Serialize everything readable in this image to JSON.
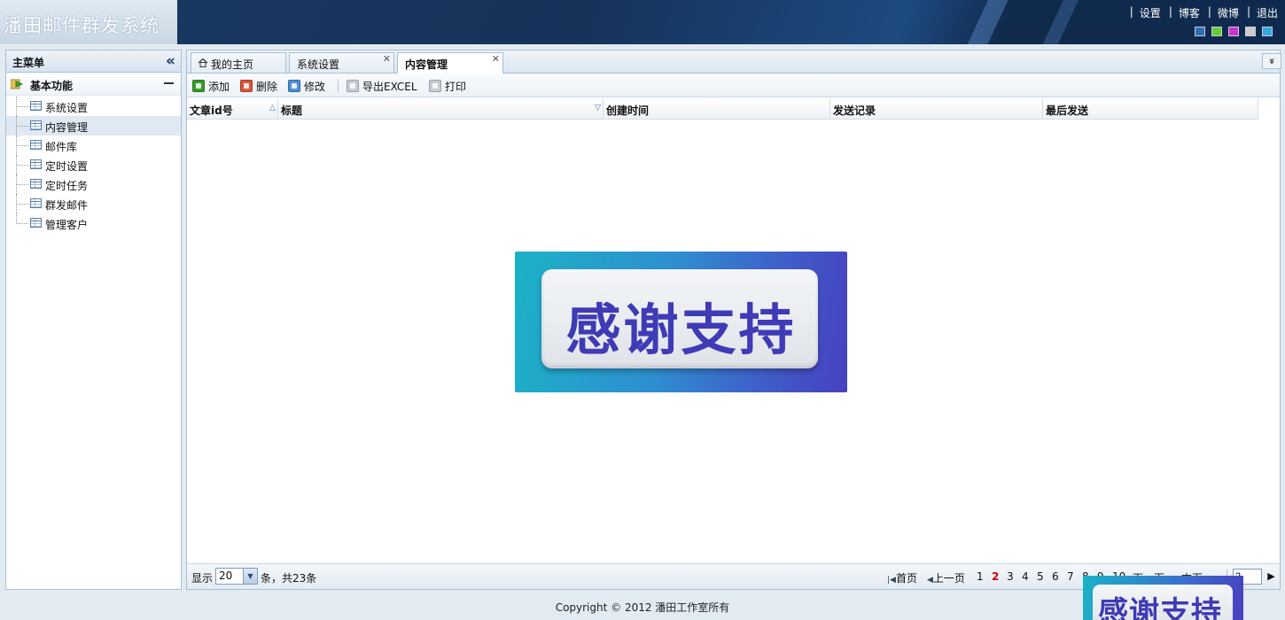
{
  "app": {
    "title": "潘田邮件群发系统"
  },
  "header": {
    "links": [
      "设置",
      "博客",
      "微博",
      "退出"
    ],
    "separator": "|",
    "themes": [
      "#2f6fb0",
      "#66cc33",
      "#cc33cc",
      "#cccccc",
      "#33aadd"
    ]
  },
  "sidebar": {
    "title": "主菜单",
    "collapse_icon": "«",
    "group": {
      "label": "基本功能",
      "items": [
        {
          "label": "系统设置"
        },
        {
          "label": "内容管理",
          "active": true
        },
        {
          "label": "邮件库"
        },
        {
          "label": "定时设置"
        },
        {
          "label": "定时任务"
        },
        {
          "label": "群发邮件"
        },
        {
          "label": "管理客户"
        }
      ]
    }
  },
  "tabs": [
    {
      "label": "我的主页",
      "closable": false
    },
    {
      "label": "系统设置",
      "closable": true
    },
    {
      "label": "内容管理",
      "closable": true,
      "active": true
    }
  ],
  "tab_menu_icon": "»",
  "toolbar": {
    "add": "添加",
    "delete": "删除",
    "edit": "修改",
    "export": "导出EXCEL",
    "print": "打印"
  },
  "grid": {
    "columns": [
      {
        "label": "文章id号",
        "sort": "△"
      },
      {
        "label": "标题",
        "sort": "▽"
      },
      {
        "label": "创建时间",
        "sort": ""
      },
      {
        "label": "发送记录",
        "sort": ""
      },
      {
        "label": "最后发送",
        "sort": ""
      }
    ],
    "rows": []
  },
  "overlay_image": {
    "text": "感谢支持"
  },
  "pager": {
    "show_label": "显示",
    "page_size": "20",
    "total_text": "条，共23条",
    "first": "首页",
    "prev": "上一页",
    "pages": [
      "1",
      "2",
      "3",
      "4",
      "5",
      "6",
      "7",
      "8",
      "9",
      "10"
    ],
    "current_page": "2",
    "next": "下一页",
    "last": "末页",
    "goto_value": "2"
  },
  "footer": {
    "copyright": "Copyright © 2012 潘田工作室所有"
  }
}
